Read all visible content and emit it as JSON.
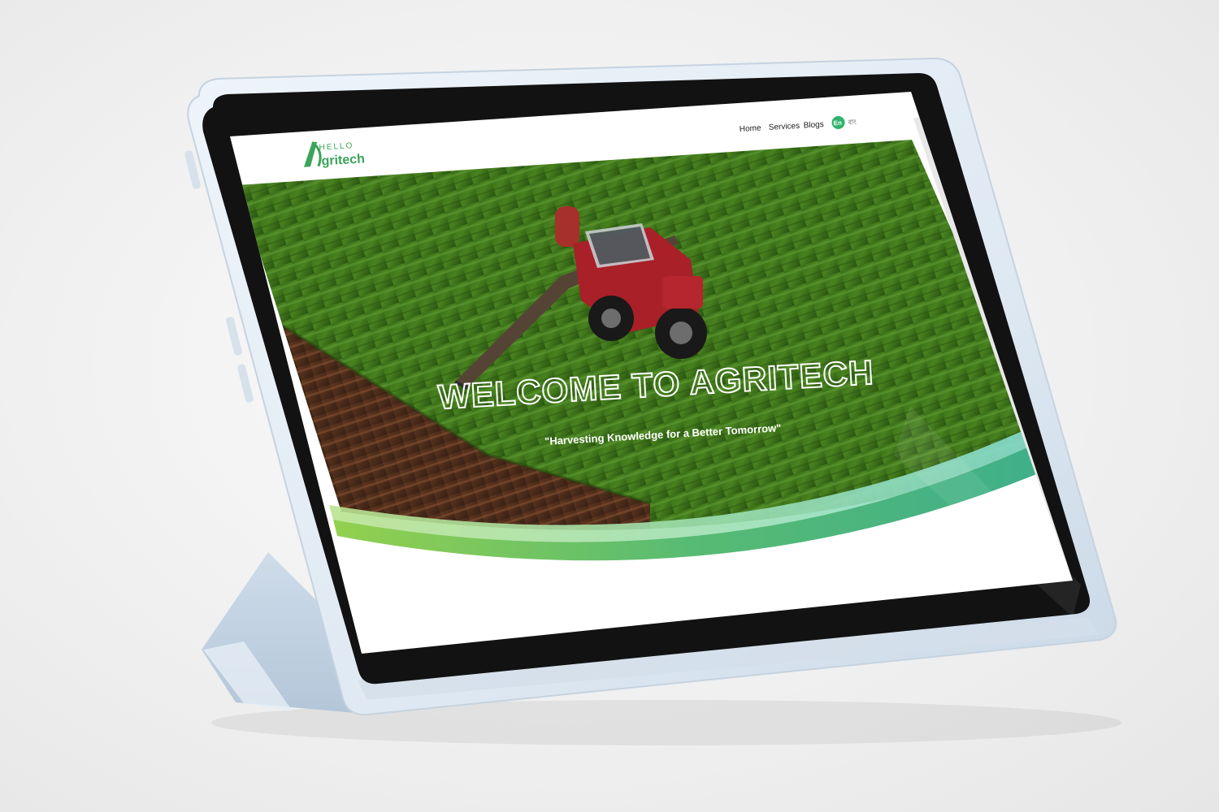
{
  "site": {
    "logo_top": "HELLO",
    "logo_bottom": "gritech",
    "logo_letter": "A",
    "brand_color": "#3aa55a"
  },
  "nav": {
    "items": [
      {
        "label": "Home"
      },
      {
        "label": "Services"
      },
      {
        "label": "Blogs"
      }
    ],
    "lang_active": "En",
    "lang_other": "বাং"
  },
  "hero": {
    "title": "WELCOME TO AGRITECH",
    "subtitle": "\"Harvesting Knowledge for a Better Tomorrow\"",
    "wave_colors": [
      "#8ccf4d",
      "#3fb887",
      "#6fd3c9"
    ]
  }
}
